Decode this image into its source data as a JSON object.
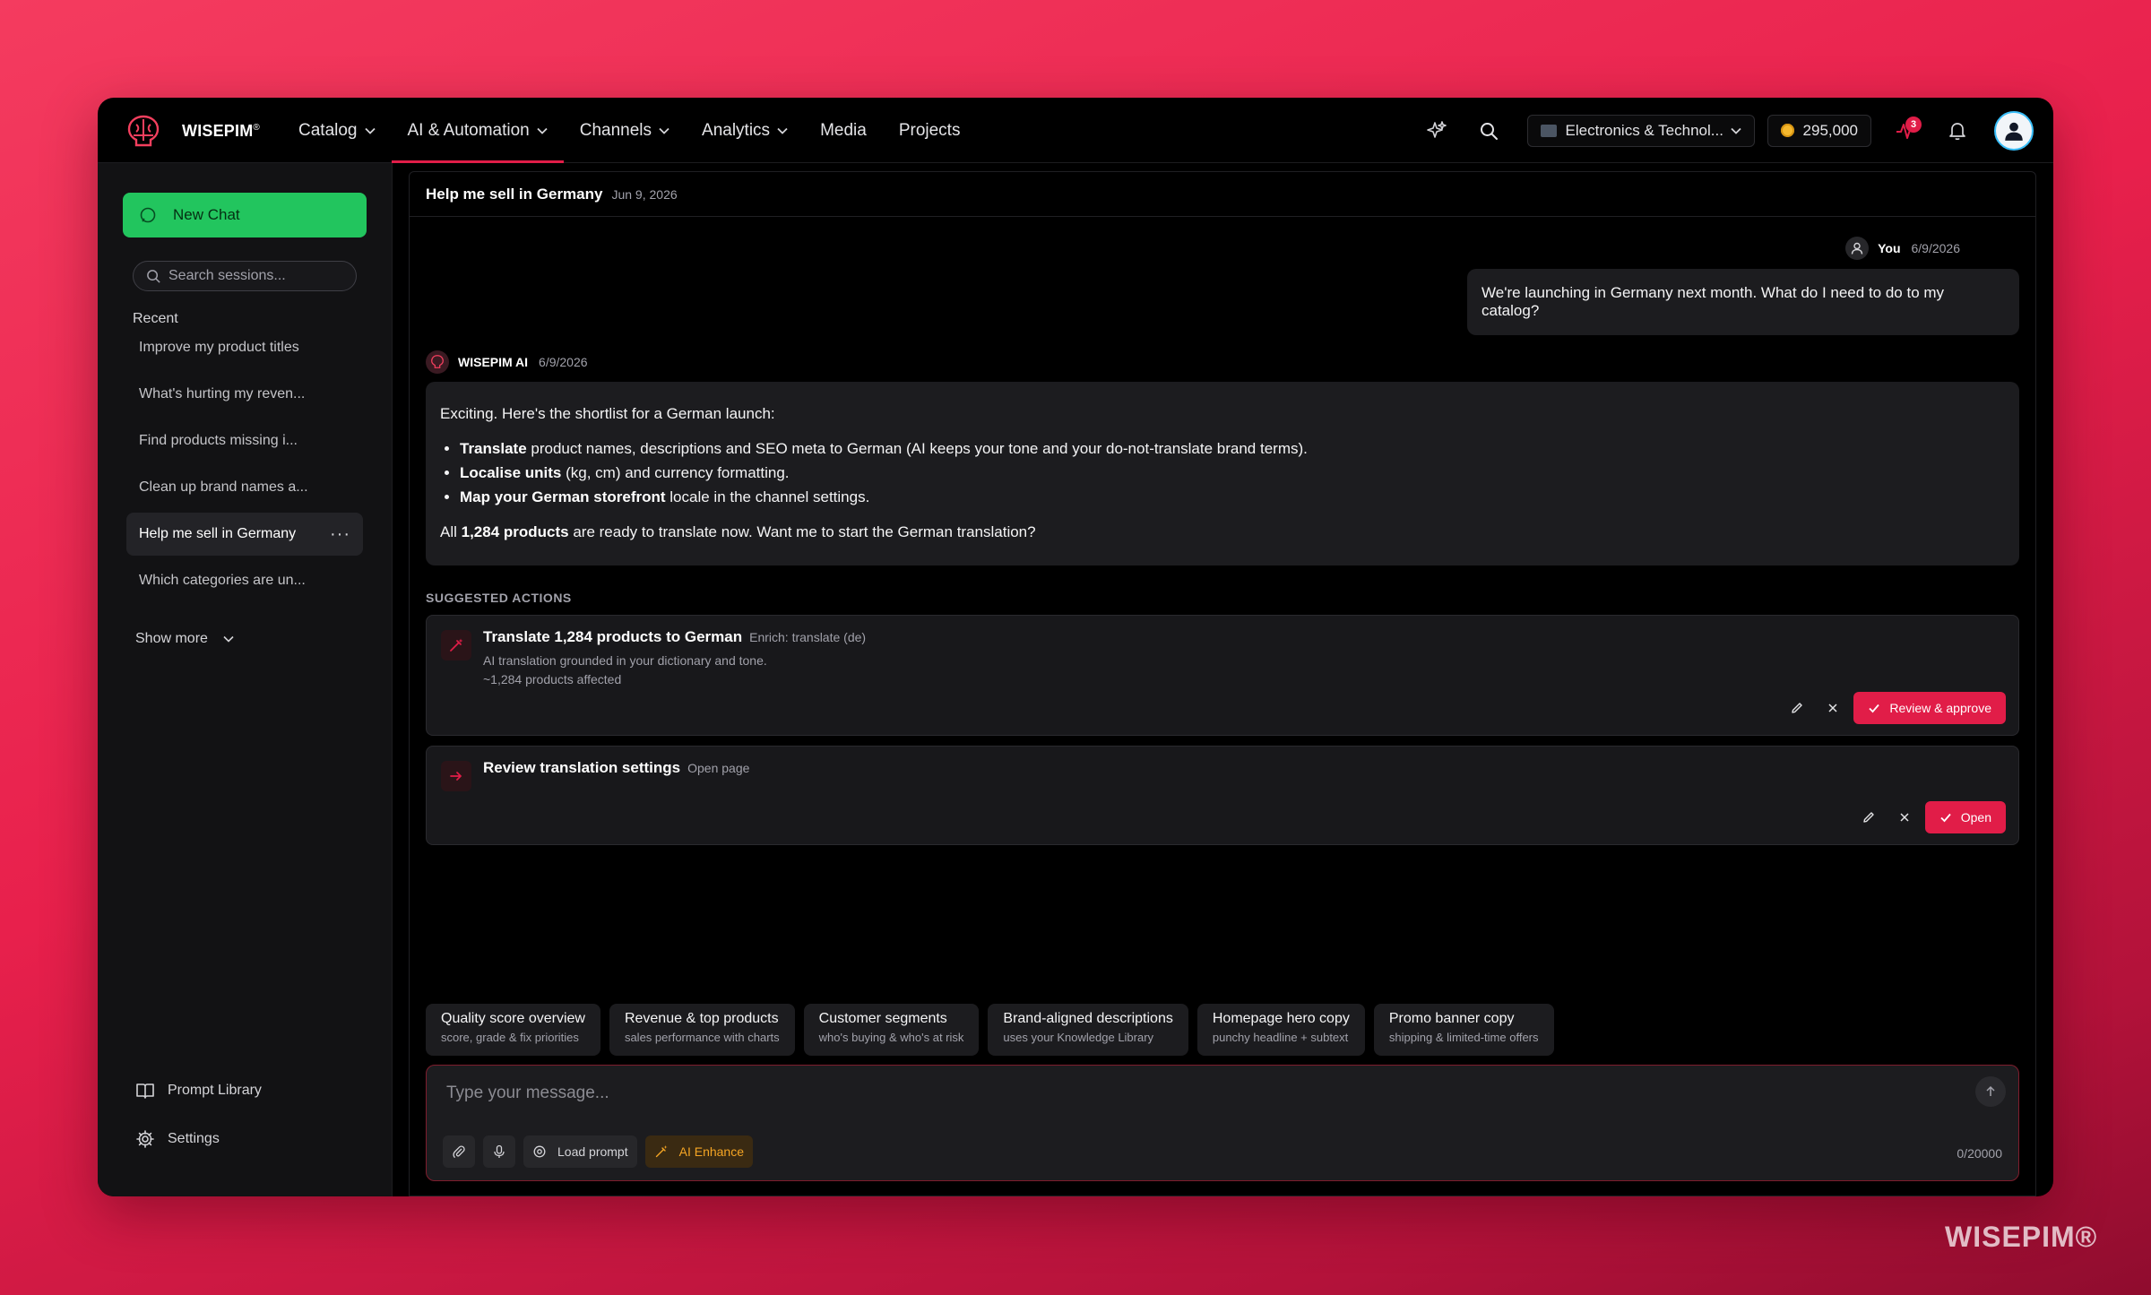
{
  "brand": {
    "name": "WISEPIM",
    "mark": "®",
    "watermark": "WISEPIM®",
    "accent": "#e11d48",
    "green": "#22c55e"
  },
  "nav": {
    "items": [
      {
        "label": "Catalog",
        "dropdown": true,
        "active": false
      },
      {
        "label": "AI & Automation",
        "dropdown": true,
        "active": true
      },
      {
        "label": "Channels",
        "dropdown": true,
        "active": false
      },
      {
        "label": "Analytics",
        "dropdown": true,
        "active": false
      },
      {
        "label": "Media",
        "dropdown": false,
        "active": false
      },
      {
        "label": "Projects",
        "dropdown": false,
        "active": false
      }
    ],
    "store": "Electronics & Technol...",
    "credits": "295,000",
    "activity_badge": "3"
  },
  "sidebar": {
    "new_chat": "New Chat",
    "search_placeholder": "Search sessions...",
    "recent_label": "Recent",
    "sessions": [
      "Improve my product titles",
      "What's hurting my reven...",
      "Find products missing i...",
      "Clean up brand names a...",
      "Help me sell in Germany",
      "Which categories are un..."
    ],
    "active_session_index": 4,
    "more_dots": "···",
    "show_more": "Show more",
    "prompt_library": "Prompt Library",
    "settings": "Settings"
  },
  "chat": {
    "title": "Help me sell in Germany",
    "date": "Jun 9, 2026",
    "user": {
      "name": "You",
      "date": "6/9/2026",
      "message": "We're launching in Germany next month. What do I need to do to my catalog?"
    },
    "ai": {
      "name": "WISEPIM AI",
      "date": "6/9/2026",
      "intro": "Exciting. Here's the shortlist for a German launch:",
      "bullets": [
        {
          "bold": "Translate",
          "rest": " product names, descriptions and SEO meta to German (AI keeps your tone and your do-not-translate brand terms)."
        },
        {
          "bold": "Localise units",
          "rest": " (kg, cm) and currency formatting."
        },
        {
          "bold": "Map your German storefront",
          "rest": " locale in the channel settings."
        }
      ],
      "outro_pre": "All ",
      "outro_bold": "1,284 products",
      "outro_post": " are ready to translate now. Want me to start the German translation?"
    },
    "suggested_label": "SUGGESTED ACTIONS",
    "actions": [
      {
        "title": "Translate 1,284 products to German",
        "tag": "Enrich: translate (de)",
        "desc1": "AI translation grounded in your dictionary and tone.",
        "desc2": "~1,284 products affected",
        "primary": "Review & approve"
      },
      {
        "title": "Review translation settings",
        "tag": "Open page",
        "desc1": "",
        "desc2": "",
        "primary": "Open"
      }
    ],
    "chips": [
      {
        "title": "Quality score overview",
        "sub": "score, grade & fix priorities"
      },
      {
        "title": "Revenue & top products",
        "sub": "sales performance with charts"
      },
      {
        "title": "Customer segments",
        "sub": "who's buying & who's at risk"
      },
      {
        "title": "Brand-aligned descriptions",
        "sub": "uses your Knowledge Library"
      },
      {
        "title": "Homepage hero copy",
        "sub": "punchy headline + subtext"
      },
      {
        "title": "Promo banner copy",
        "sub": "shipping & limited-time offers"
      }
    ],
    "composer": {
      "placeholder": "Type your message...",
      "load_prompt": "Load prompt",
      "ai_enhance": "AI Enhance",
      "char_count": "0/20000"
    }
  }
}
